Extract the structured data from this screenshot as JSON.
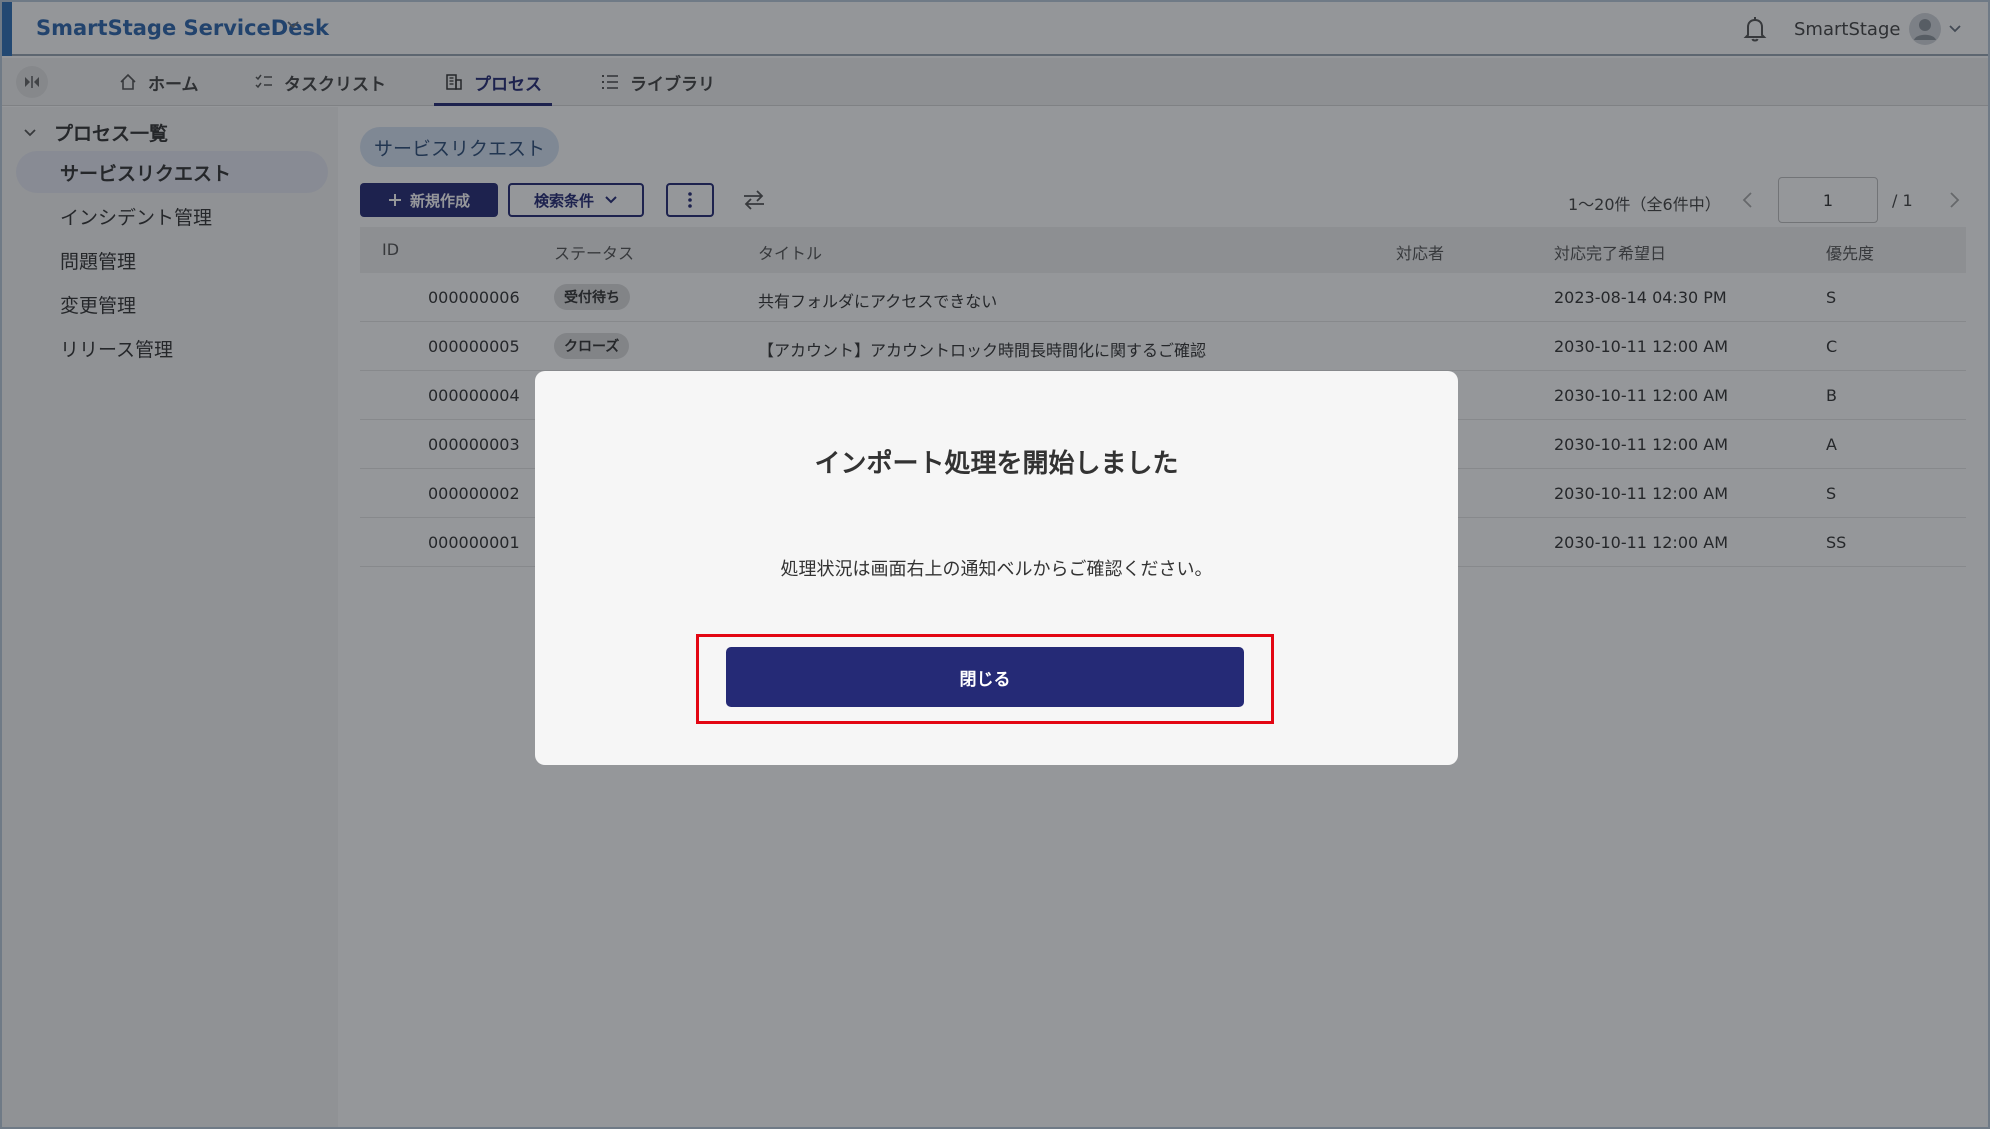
{
  "header": {
    "brand": "SmartStage ServiceDesk",
    "user_name": "SmartStage",
    "colors": {
      "accent": "#2f6fb7",
      "brand_text": "#2e67ad",
      "primary": "#252a76"
    }
  },
  "tabs": [
    {
      "label": "ホーム",
      "icon": "home-icon"
    },
    {
      "label": "タスクリスト",
      "icon": "checklist-icon"
    },
    {
      "label": "プロセス",
      "icon": "building-icon",
      "active": true
    },
    {
      "label": "ライブラリ",
      "icon": "list-icon"
    }
  ],
  "sidebar": {
    "heading": "プロセス一覧",
    "items": [
      {
        "label": "サービスリクエスト",
        "active": true
      },
      {
        "label": "インシデント管理"
      },
      {
        "label": "問題管理"
      },
      {
        "label": "変更管理"
      },
      {
        "label": "リリース管理"
      }
    ]
  },
  "main": {
    "chip": "サービスリクエスト",
    "new_button": "新規作成",
    "search_button": "検索条件",
    "pager": {
      "range": "1〜20件（全6件中）",
      "page": "1",
      "total": "/ 1"
    }
  },
  "table": {
    "headers": [
      "ID",
      "ステータス",
      "タイトル",
      "対応者",
      "対応完了希望日",
      "優先度"
    ],
    "rows": [
      {
        "id": "000000006",
        "status": "受付待ち",
        "title": "共有フォルダにアクセスできない",
        "assignee": "",
        "due": "2023-08-14 04:30 PM",
        "priority": "S"
      },
      {
        "id": "000000005",
        "status": "クローズ",
        "title": "【アカウント】アカウントロック時間長時間化に関するご確認",
        "assignee": "",
        "due": "2030-10-11 12:00 AM",
        "priority": "C"
      },
      {
        "id": "000000004",
        "status": "",
        "title": "",
        "assignee": "",
        "due": "2030-10-11 12:00 AM",
        "priority": "B"
      },
      {
        "id": "000000003",
        "status": "",
        "title": "",
        "assignee": "",
        "due": "2030-10-11 12:00 AM",
        "priority": "A"
      },
      {
        "id": "000000002",
        "status": "",
        "title": "",
        "assignee": "",
        "due": "2030-10-11 12:00 AM",
        "priority": "S"
      },
      {
        "id": "000000001",
        "status": "",
        "title": "",
        "assignee": "",
        "due": "2030-10-11 12:00 AM",
        "priority": "SS"
      }
    ]
  },
  "modal": {
    "title": "インポート処理を開始しました",
    "message": "処理状況は画面右上の通知ベルからご確認ください。",
    "close_label": "閉じる",
    "highlight_color": "#e30613"
  }
}
